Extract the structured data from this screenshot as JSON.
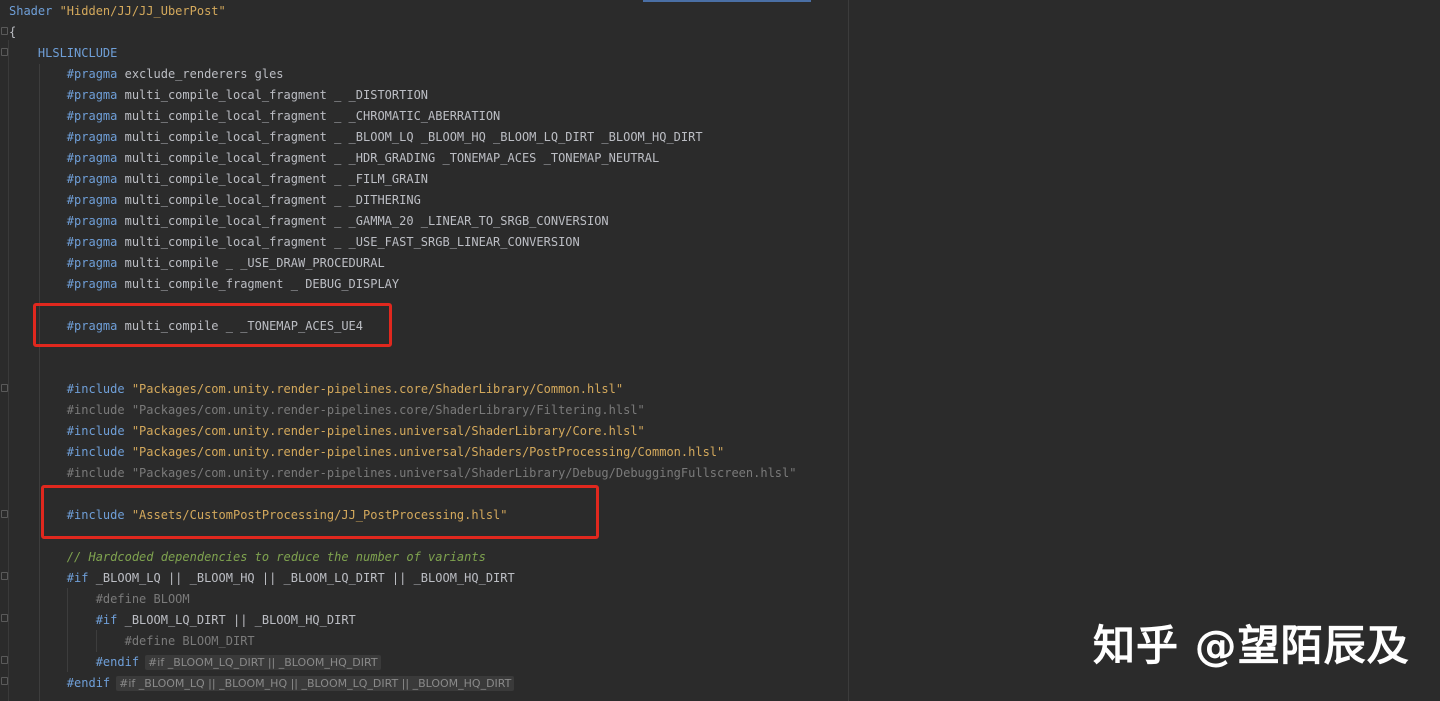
{
  "editor": {
    "lines": [
      {
        "tokens": [
          {
            "t": "Shader ",
            "c": "kw"
          },
          {
            "t": "\"Hidden/JJ/JJ_UberPost\"",
            "c": "str"
          }
        ]
      },
      {
        "tokens": [
          {
            "t": "{",
            "c": "plain"
          }
        ]
      },
      {
        "tokens": [
          {
            "t": "    HLSLINCLUDE",
            "c": "kw"
          }
        ]
      },
      {
        "tokens": [
          {
            "t": "        #pragma ",
            "c": "kw"
          },
          {
            "t": "exclude_renderers gles",
            "c": "plain"
          }
        ]
      },
      {
        "tokens": [
          {
            "t": "        #pragma ",
            "c": "kw"
          },
          {
            "t": "multi_compile_local_fragment _ _DISTORTION",
            "c": "plain"
          }
        ]
      },
      {
        "tokens": [
          {
            "t": "        #pragma ",
            "c": "kw"
          },
          {
            "t": "multi_compile_local_fragment _ _CHROMATIC_ABERRATION",
            "c": "plain"
          }
        ]
      },
      {
        "tokens": [
          {
            "t": "        #pragma ",
            "c": "kw"
          },
          {
            "t": "multi_compile_local_fragment _ _BLOOM_LQ _BLOOM_HQ _BLOOM_LQ_DIRT _BLOOM_HQ_DIRT",
            "c": "plain"
          }
        ]
      },
      {
        "tokens": [
          {
            "t": "        #pragma ",
            "c": "kw"
          },
          {
            "t": "multi_compile_local_fragment _ _HDR_GRADING _TONEMAP_ACES _TONEMAP_NEUTRAL",
            "c": "plain"
          }
        ]
      },
      {
        "tokens": [
          {
            "t": "        #pragma ",
            "c": "kw"
          },
          {
            "t": "multi_compile_local_fragment _ _FILM_GRAIN",
            "c": "plain"
          }
        ]
      },
      {
        "tokens": [
          {
            "t": "        #pragma ",
            "c": "kw"
          },
          {
            "t": "multi_compile_local_fragment _ _DITHERING",
            "c": "plain"
          }
        ]
      },
      {
        "tokens": [
          {
            "t": "        #pragma ",
            "c": "kw"
          },
          {
            "t": "multi_compile_local_fragment _ _GAMMA_20 _LINEAR_TO_SRGB_CONVERSION",
            "c": "plain"
          }
        ]
      },
      {
        "tokens": [
          {
            "t": "        #pragma ",
            "c": "kw"
          },
          {
            "t": "multi_compile_local_fragment _ _USE_FAST_SRGB_LINEAR_CONVERSION",
            "c": "plain"
          }
        ]
      },
      {
        "tokens": [
          {
            "t": "        #pragma ",
            "c": "kw"
          },
          {
            "t": "multi_compile _ _USE_DRAW_PROCEDURAL",
            "c": "plain"
          }
        ]
      },
      {
        "tokens": [
          {
            "t": "        #pragma ",
            "c": "kw"
          },
          {
            "t": "multi_compile_fragment _ DEBUG_DISPLAY",
            "c": "plain"
          }
        ]
      },
      {
        "tokens": []
      },
      {
        "tokens": [
          {
            "t": "        #pragma ",
            "c": "kw"
          },
          {
            "t": "multi_compile _ _TONEMAP_ACES_UE4",
            "c": "plain"
          }
        ]
      },
      {
        "tokens": []
      },
      {
        "tokens": []
      },
      {
        "tokens": [
          {
            "t": "        #include ",
            "c": "kw"
          },
          {
            "t": "\"Packages/com.unity.render-pipelines.core/ShaderLibrary/Common.hlsl\"",
            "c": "str"
          }
        ]
      },
      {
        "tokens": [
          {
            "t": "        #include \"Packages/com.unity.render-pipelines.core/ShaderLibrary/Filtering.hlsl\"",
            "c": "dim"
          }
        ]
      },
      {
        "tokens": [
          {
            "t": "        #include ",
            "c": "kw"
          },
          {
            "t": "\"Packages/com.unity.render-pipelines.universal/ShaderLibrary/Core.hlsl\"",
            "c": "str"
          }
        ]
      },
      {
        "tokens": [
          {
            "t": "        #include ",
            "c": "kw"
          },
          {
            "t": "\"Packages/com.unity.render-pipelines.universal/Shaders/PostProcessing/Common.hlsl\"",
            "c": "str"
          }
        ]
      },
      {
        "tokens": [
          {
            "t": "        #include \"Packages/com.unity.render-pipelines.universal/ShaderLibrary/Debug/DebuggingFullscreen.hlsl\"",
            "c": "dim"
          }
        ]
      },
      {
        "tokens": []
      },
      {
        "tokens": [
          {
            "t": "        #include ",
            "c": "kw"
          },
          {
            "t": "\"Assets/CustomPostProcessing/JJ_PostProcessing.hlsl\"",
            "c": "str"
          }
        ]
      },
      {
        "tokens": []
      },
      {
        "tokens": [
          {
            "t": "        // Hardcoded dependencies to reduce the number of variants",
            "c": "cmt"
          }
        ]
      },
      {
        "tokens": [
          {
            "t": "        #if ",
            "c": "kw"
          },
          {
            "t": "_BLOOM_LQ || _BLOOM_HQ || _BLOOM_LQ_DIRT || _BLOOM_HQ_DIRT",
            "c": "plain"
          }
        ]
      },
      {
        "tokens": [
          {
            "t": "            #define BLOOM",
            "c": "dim"
          }
        ]
      },
      {
        "tokens": [
          {
            "t": "            #if ",
            "c": "kw"
          },
          {
            "t": "_BLOOM_LQ_DIRT || _BLOOM_HQ_DIRT",
            "c": "plain"
          }
        ]
      },
      {
        "tokens": [
          {
            "t": "                #define BLOOM_DIRT",
            "c": "dim"
          }
        ]
      },
      {
        "tokens": [
          {
            "t": "            #endif",
            "c": "kw"
          }
        ],
        "hint": "#if _BLOOM_LQ_DIRT || _BLOOM_HQ_DIRT"
      },
      {
        "tokens": [
          {
            "t": "        #endif",
            "c": "kw"
          }
        ],
        "hint": "#if _BLOOM_LQ || _BLOOM_HQ || _BLOOM_LQ_DIRT || _BLOOM_HQ_DIRT"
      }
    ]
  },
  "watermark": {
    "text": "知乎 @望陌辰及"
  }
}
